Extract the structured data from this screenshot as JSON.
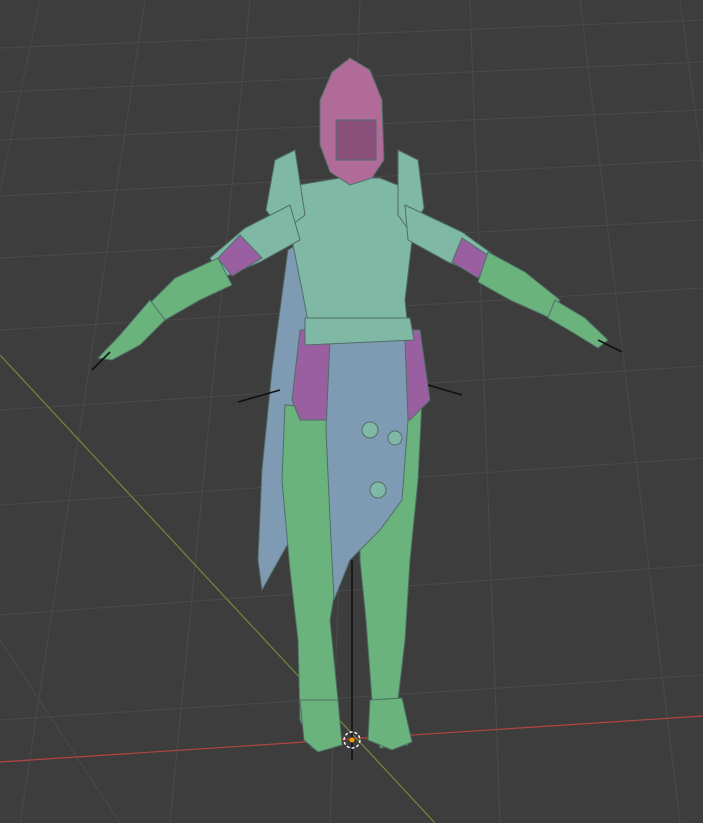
{
  "viewport": {
    "background": "#3d3d3d",
    "grid_color": "#4a4a4a",
    "x_axis_color": "#b4443f",
    "y_axis_color": "#6e8b3d"
  },
  "model": {
    "helmet_color": "#b06b98",
    "armor_color": "#7fb8a4",
    "cloth_color": "#7f9bb4",
    "leg_color": "#6ab37c",
    "skin_color": "#9a5fa0",
    "armature_color": "#111111"
  },
  "origin": {
    "icon": "origin-cursor-icon",
    "color": "#ff9900"
  }
}
